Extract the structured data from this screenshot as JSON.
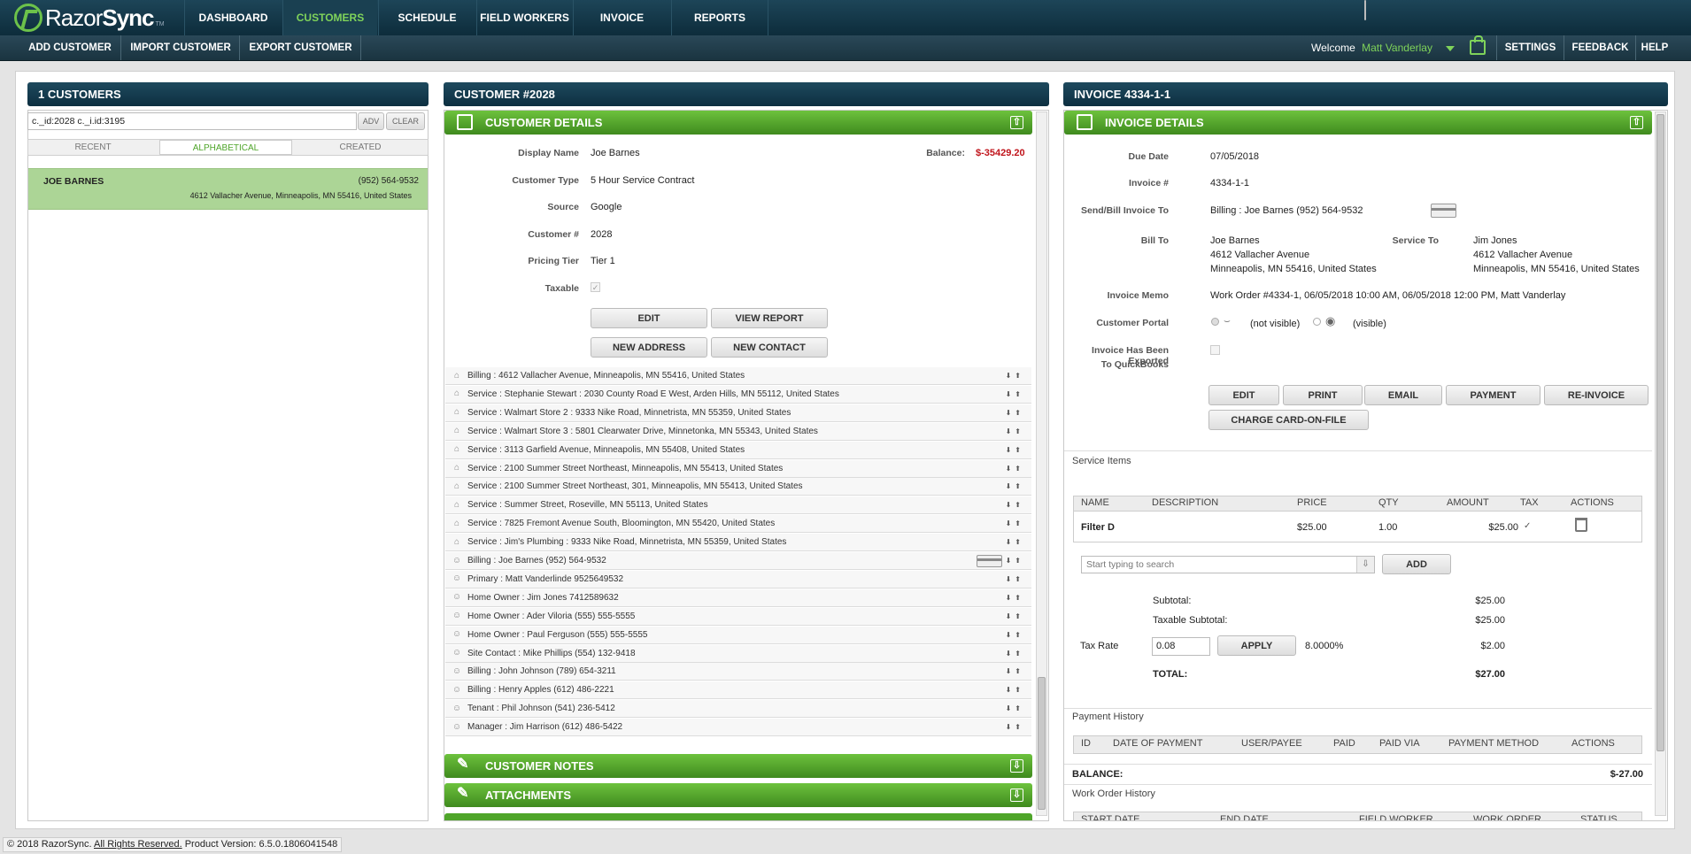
{
  "app": {
    "logo_text_1": "Razor",
    "logo_text_2": "Sync",
    "tm": "TM"
  },
  "nav": {
    "dashboard": "DASHBOARD",
    "customers": "CUSTOMERS",
    "schedule": "SCHEDULE",
    "field_workers": "FIELD WORKERS",
    "invoice": "INVOICE",
    "reports": "REPORTS"
  },
  "subnav": {
    "add": "ADD CUSTOMER",
    "import": "IMPORT CUSTOMER",
    "export": "EXPORT CUSTOMER",
    "welcome": "Welcome",
    "user": "Matt Vanderlay",
    "settings": "SETTINGS",
    "feedback": "FEEDBACK",
    "help": "HELP"
  },
  "left": {
    "title": "1 CUSTOMERS",
    "search_value": "c._id:2028 c._i.id:3195",
    "adv": "ADV",
    "clear": "CLEAR",
    "tabs": [
      "RECENT",
      "ALPHABETICAL",
      "CREATED"
    ],
    "customer": {
      "name": "JOE BARNES",
      "phone": "(952) 564-9532",
      "address": "4612 Vallacher Avenue, Minneapolis, MN 55416, United States"
    }
  },
  "mid": {
    "title": "CUSTOMER #2028",
    "details_title": "CUSTOMER DETAILS",
    "fields": [
      {
        "label": "Display Name",
        "value": "Joe Barnes"
      },
      {
        "label": "Customer Type",
        "value": "5 Hour Service Contract"
      },
      {
        "label": "Source",
        "value": "Google"
      },
      {
        "label": "Customer #",
        "value": "2028"
      },
      {
        "label": "Pricing Tier",
        "value": "Tier 1"
      },
      {
        "label": "Taxable",
        "value": ""
      }
    ],
    "balance_label": "Balance:",
    "balance_value": "$-35429.20",
    "buttons": {
      "edit": "EDIT",
      "view_report": "VIEW REPORT",
      "new_address": "NEW ADDRESS",
      "new_contact": "NEW CONTACT"
    },
    "addresses": [
      "Billing : 4612 Vallacher Avenue, Minneapolis, MN 55416, United States",
      "Service : Stephanie Stewart : 2030 County Road E West, Arden Hills, MN 55112, United States",
      "Service : Walmart Store 2 : 9333 Nike Road, Minnetrista, MN 55359, United States",
      "Service : Walmart Store 3 : 5801 Clearwater Drive, Minnetonka, MN 55343, United States",
      "Service : 3113 Garfield Avenue, Minneapolis, MN 55408, United States",
      "Service : 2100 Summer Street Northeast, Minneapolis, MN 55413, United States",
      "Service : 2100 Summer Street Northeast, 301, Minneapolis, MN 55413, United States",
      "Service : Summer Street, Roseville, MN 55113, United States",
      "Service : 7825 Fremont Avenue South, Bloomington, MN 55420, United States",
      "Service : Jim's Plumbing : 9333 Nike Road, Minnetrista, MN 55359, United States"
    ],
    "contacts": [
      "Billing : Joe Barnes (952) 564-9532",
      "Primary : Matt Vanderlinde 9525649532",
      "Home Owner : Jim Jones 7412589632",
      "Home Owner : Ader Viloria (555) 555-5555",
      "Home Owner : Paul Ferguson (555) 555-5555",
      "Site Contact : Mike Phillips (554) 132-9418",
      "Billing : John Johnson (789) 654-3211",
      "Billing : Henry Apples (612) 486-2221",
      "Tenant : Phil Johnson (541) 236-5412",
      "Manager : Jim Harrison (612) 486-5422"
    ],
    "notes_title": "CUSTOMER NOTES",
    "attachments_title": "ATTACHMENTS"
  },
  "right": {
    "title": "INVOICE 4334-1-1",
    "details_title": "INVOICE DETAILS",
    "due_label": "Due Date",
    "due": "07/05/2018",
    "inv_label": "Invoice #",
    "inv": "4334-1-1",
    "send_label": "Send/Bill Invoice To",
    "send": "Billing : Joe Barnes (952) 564-9532",
    "billto_label": "Bill To",
    "billto": [
      "Joe Barnes",
      "4612 Vallacher Avenue",
      "Minneapolis, MN 55416, United States"
    ],
    "serviceto_label": "Service To",
    "serviceto": [
      "Jim Jones",
      "4612 Vallacher Avenue",
      "Minneapolis, MN 55416, United States"
    ],
    "memo_label": "Invoice Memo",
    "memo": "Work Order #4334-1, 06/05/2018 10:00 AM, 06/05/2018 12:00 PM, Matt Vanderlay",
    "portal_label": "Customer Portal",
    "not_visible": "(not visible)",
    "visible": "(visible)",
    "exported_label_1": "Invoice Has Been Exported",
    "exported_label_2": "To QuickBooks",
    "buttons": {
      "edit": "EDIT",
      "print": "PRINT",
      "email": "EMAIL",
      "payment": "PAYMENT",
      "reinvoice": "RE-INVOICE",
      "charge": "CHARGE CARD-ON-FILE"
    },
    "service_items_label": "Service Items",
    "columns": [
      "NAME",
      "DESCRIPTION",
      "PRICE",
      "QTY",
      "AMOUNT",
      "TAX",
      "ACTIONS"
    ],
    "item": {
      "name": "Filter D",
      "description": "",
      "price": "$25.00",
      "qty": "1.00",
      "amount": "$25.00"
    },
    "search_placeholder": "Start typing to search",
    "add": "ADD",
    "subtotal_label": "Subtotal:",
    "subtotal": "$25.00",
    "taxable_label": "Taxable Subtotal:",
    "taxable": "$25.00",
    "taxrate_label": "Tax Rate",
    "taxrate": "0.08",
    "apply": "APPLY",
    "taxpct": "8.0000%",
    "tax": "$2.00",
    "total_label": "TOTAL:",
    "total": "$27.00",
    "payment_history_label": "Payment History",
    "pay_columns": [
      "ID",
      "DATE OF PAYMENT",
      "USER/PAYEE",
      "PAID",
      "PAID VIA",
      "PAYMENT METHOD",
      "ACTIONS"
    ],
    "balance_label": "BALANCE:",
    "balance": "$-27.00",
    "wo_history_label": "Work Order History",
    "wo_columns": [
      "START DATE",
      "END DATE",
      "FIELD WORKER",
      "WORK ORDER",
      "STATUS"
    ]
  },
  "footer": {
    "copy": "© 2018 RazorSync.",
    "rights": "All Rights Reserved.",
    "version": "Product Version: 6.5.0.1806041548"
  },
  "colors": {
    "accent": "#7fd35a",
    "header": "#0d2f40",
    "green": "#4fa52a",
    "negative": "#c0141b"
  }
}
